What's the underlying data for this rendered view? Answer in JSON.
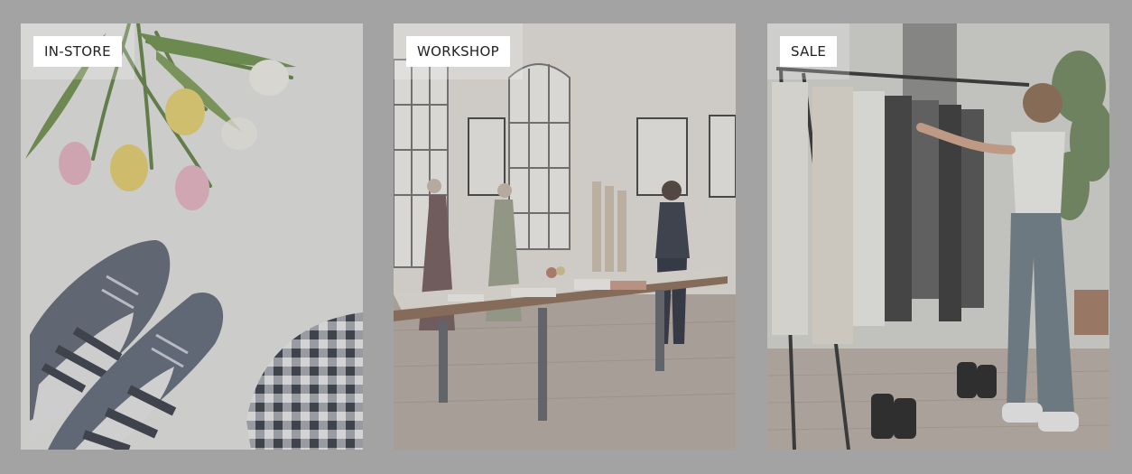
{
  "gallery": {
    "cards": [
      {
        "tag": "IN-STORE",
        "image": "flat-lay-tulips-sneakers"
      },
      {
        "tag": "WORKSHOP",
        "image": "fashion-workshop-studio"
      },
      {
        "tag": "SALE",
        "image": "clothing-rack-shopper"
      }
    ]
  },
  "colors": {
    "page_background": "#a3a3a3",
    "tag_background": "#ffffff",
    "tag_text": "#222222"
  }
}
